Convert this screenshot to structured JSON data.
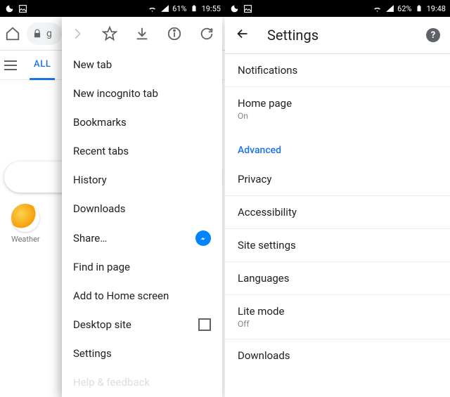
{
  "left": {
    "statusbar": {
      "battery": "61%",
      "time": "19:55"
    },
    "url_hint": "g",
    "tab_all": "ALL",
    "weather_label": "Weather",
    "menu_top_icons": [
      "forward",
      "star",
      "download",
      "info",
      "reload"
    ],
    "menu_items": [
      "New tab",
      "New incognito tab",
      "Bookmarks",
      "Recent tabs",
      "History",
      "Downloads",
      "Share…",
      "Find in page",
      "Add to Home screen",
      "Desktop site",
      "Settings",
      "Help & feedback"
    ]
  },
  "right": {
    "statusbar": {
      "battery": "62%",
      "time": "19:48"
    },
    "title": "Settings",
    "rows": [
      {
        "label": "Notifications"
      },
      {
        "label": "Home page",
        "sub": "On"
      }
    ],
    "section": "Advanced",
    "advanced_rows": [
      {
        "label": "Privacy"
      },
      {
        "label": "Accessibility"
      },
      {
        "label": "Site settings"
      },
      {
        "label": "Languages"
      },
      {
        "label": "Lite mode",
        "sub": "Off"
      },
      {
        "label": "Downloads"
      }
    ]
  }
}
